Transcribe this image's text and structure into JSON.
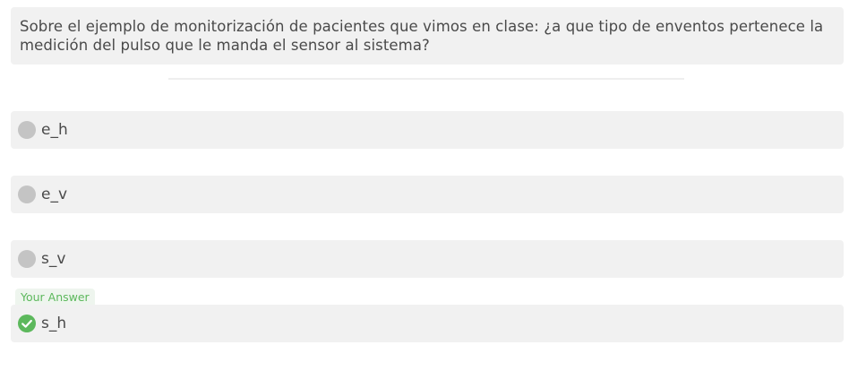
{
  "question": {
    "text": "Sobre el ejemplo de monitorización de pacientes que vimos en clase: ¿a que tipo de enventos pertenece la medición del pulso que le manda el sensor al sistema?"
  },
  "options": [
    {
      "label": "e_h",
      "state": "unselected",
      "icon": "radio-icon"
    },
    {
      "label": "e_v",
      "state": "unselected",
      "icon": "radio-icon"
    },
    {
      "label": "s_v",
      "state": "unselected",
      "icon": "radio-icon"
    },
    {
      "label": "s_h",
      "state": "selected-correct",
      "icon": "check-circle-icon"
    }
  ],
  "your_answer_badge": "Your Answer",
  "colors": {
    "correct": "#5cb85c",
    "radio": "#c4c4c4",
    "box_bg": "#f1f1f1"
  }
}
